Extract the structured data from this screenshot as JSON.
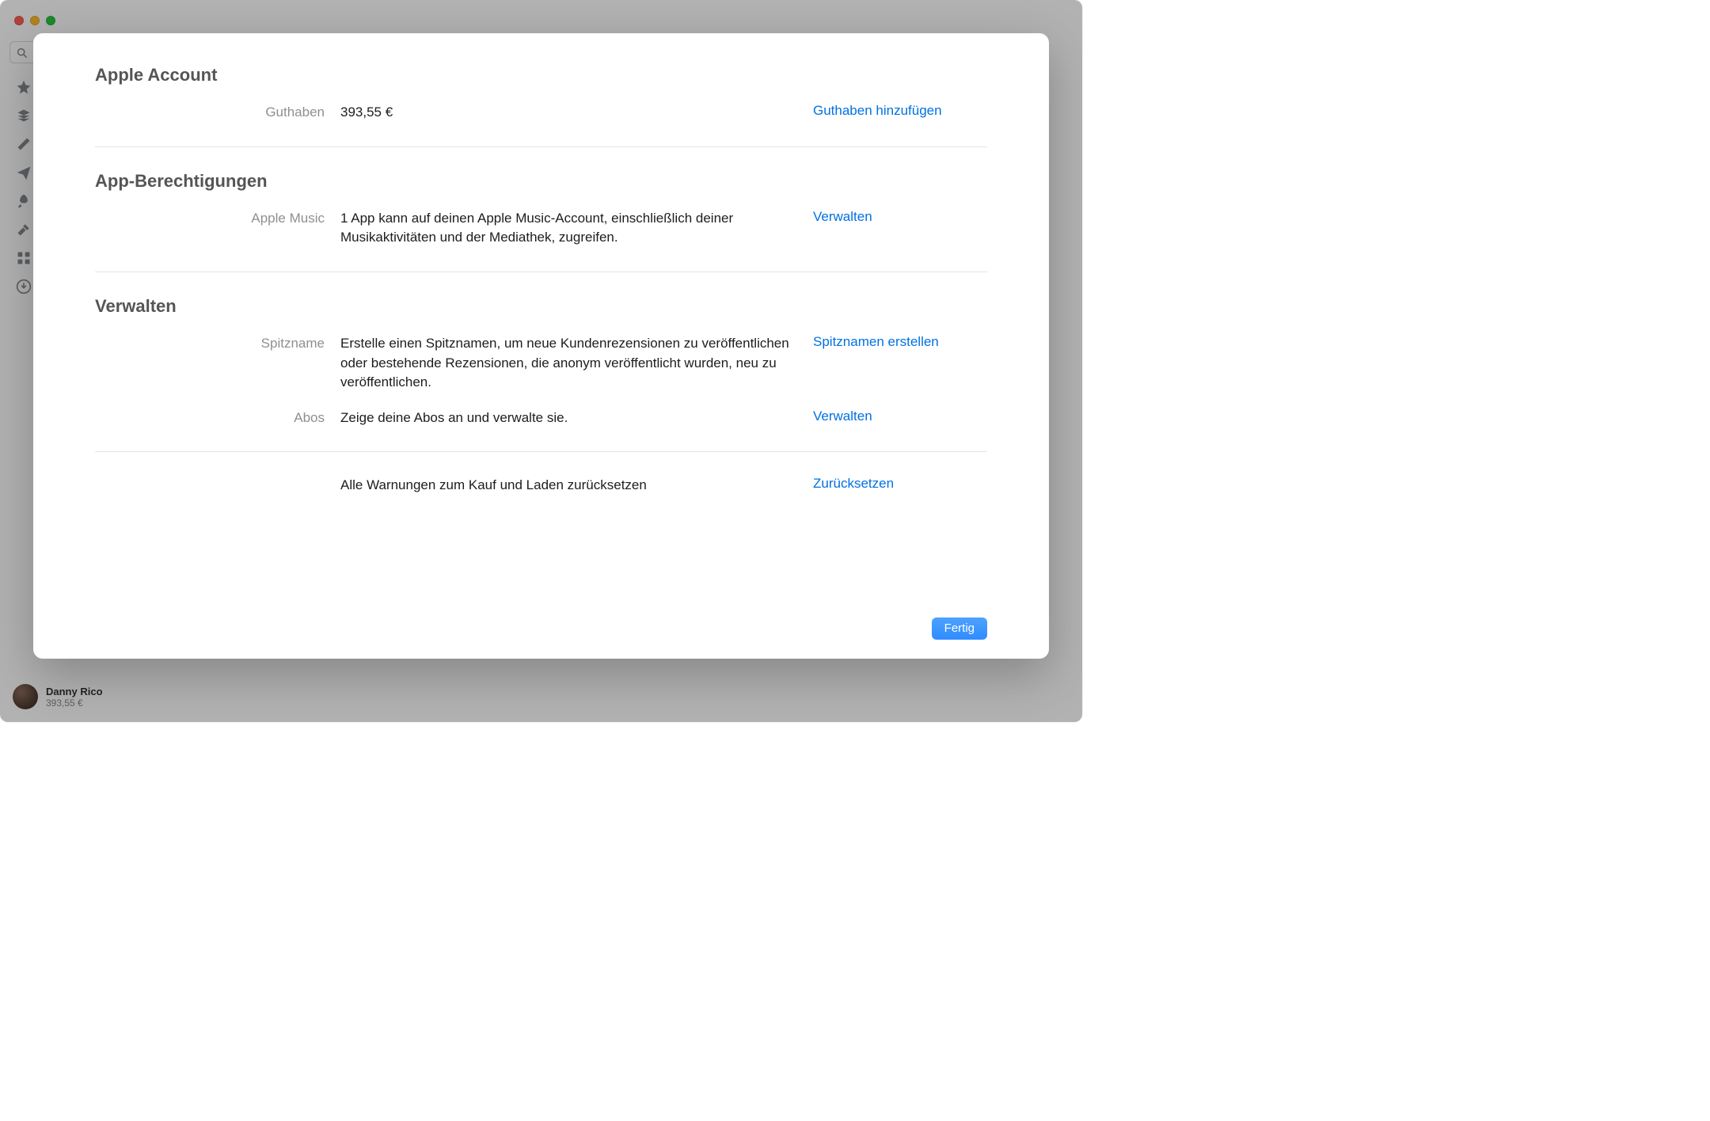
{
  "search": {
    "placeholder": ""
  },
  "user": {
    "name": "Danny Rico",
    "balance": "393,55 €"
  },
  "sheet": {
    "sections": [
      {
        "heading": "Apple Account",
        "rows": [
          {
            "label": "Guthaben",
            "value": "393,55 €",
            "action": "Guthaben hinzufügen"
          }
        ]
      },
      {
        "heading": "App-Berechtigungen",
        "rows": [
          {
            "label": "Apple Music",
            "value": "1 App kann auf deinen Apple Music-Account, einschließlich deiner Musikaktivitäten und der Mediathek, zugreifen.",
            "action": "Verwalten"
          }
        ]
      },
      {
        "heading": "Verwalten",
        "rows": [
          {
            "label": "Spitzname",
            "value": "Erstelle einen Spitznamen, um neue Kundenrezensionen zu veröffentlichen oder bestehende Rezensionen, die anonym veröffentlicht wurden, neu zu veröffentlichen.",
            "action": "Spitznamen erstellen"
          },
          {
            "label": "Abos",
            "value": "Zeige deine Abos an und verwalte sie.",
            "action": "Verwalten"
          }
        ]
      },
      {
        "heading": "",
        "rows": [
          {
            "label": "",
            "value": "Alle Warnungen zum Kauf und Laden zurücksetzen",
            "action": "Zurücksetzen"
          }
        ]
      }
    ],
    "done": "Fertig"
  }
}
